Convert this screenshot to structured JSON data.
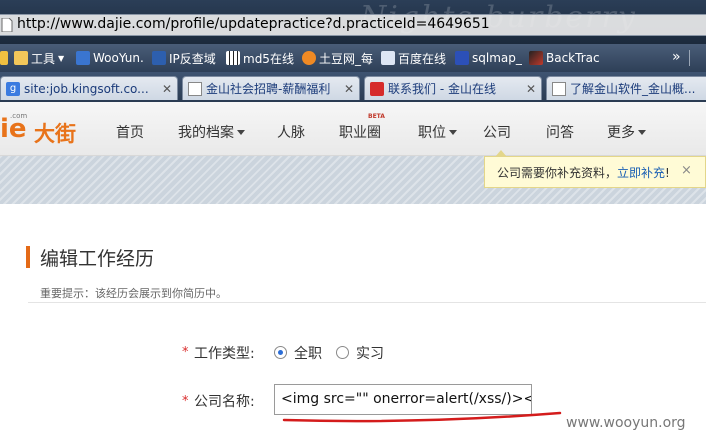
{
  "browser": {
    "url": "http://www.dajie.com/profile/updatepractice?d.practiceId=4649651",
    "background_text": "Nights burberry"
  },
  "bookmarks": [
    {
      "label": "工具",
      "icon": "folder-icon"
    },
    {
      "label": "WooYun.",
      "icon": "wooyun-icon"
    },
    {
      "label": "IP反查域",
      "icon": "ip-icon"
    },
    {
      "label": "md5在线",
      "icon": "grid-icon"
    },
    {
      "label": "土豆网_每",
      "icon": "tudou-icon"
    },
    {
      "label": "百度在线",
      "icon": "baidu-icon"
    },
    {
      "label": "sqlmap_",
      "icon": "sqlmap-icon"
    },
    {
      "label": "BackTrac",
      "icon": "backtrack-icon"
    }
  ],
  "tabs": [
    {
      "title": "site:job.kingsoft.co...",
      "icon": "google-icon"
    },
    {
      "title": "金山社会招聘-薪酬福利",
      "icon": "page-icon"
    },
    {
      "title": "联系我们 - 金山在线",
      "icon": "kingsoft-icon"
    },
    {
      "title": "了解金山软件_金山概...",
      "icon": "page-icon"
    }
  ],
  "site": {
    "logo_com": ".com",
    "logo_text": "大街",
    "logo_prefix": "ie",
    "nav": [
      "首页",
      "我的档案",
      "人脉",
      "职业圈",
      "职位",
      "公司",
      "问答",
      "更多"
    ],
    "beta": "BETA"
  },
  "notice": {
    "text": "公司需要你补充资料，",
    "link": "立即补充",
    "suffix": "!",
    "close": "×"
  },
  "form": {
    "title": "编辑工作经历",
    "hint": "重要提示：该经历会展示到你简历中。",
    "required_mark": "*",
    "work_type_label": "工作类型:",
    "options": [
      "全职",
      "实习"
    ],
    "selected_option": "全职",
    "company_label": "公司名称:",
    "company_value": "<img src=\"\" onerror=alert(/xss/)></img"
  },
  "watermark": "www.wooyun.org",
  "colors": {
    "accent": "#e46a17",
    "link": "#1a5fb4",
    "required": "#d92b2b",
    "annotation": "#d41c1c"
  }
}
